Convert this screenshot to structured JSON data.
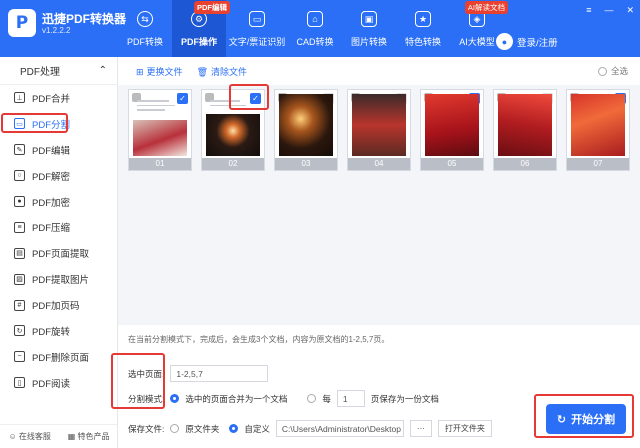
{
  "app": {
    "name": "迅捷PDF转换器",
    "version": "v1.2.2.2",
    "logo_letter": "P"
  },
  "nav": {
    "items": [
      {
        "label": "PDF转换",
        "icon": "convert-icon"
      },
      {
        "label": "PDF操作",
        "icon": "gear-icon",
        "badge": "PDF编辑",
        "active": true
      },
      {
        "label": "文字/票证识别",
        "icon": "scan-icon"
      },
      {
        "label": "CAD转换",
        "icon": "cad-icon"
      },
      {
        "label": "图片转换",
        "icon": "image-icon"
      },
      {
        "label": "特色转换",
        "icon": "star-icon"
      },
      {
        "label": "AI大模型",
        "icon": "ai-icon",
        "badge": "AI解读文档"
      }
    ],
    "login": "登录/注册"
  },
  "sidebar": {
    "header": "PDF处理",
    "items": [
      {
        "label": "PDF合并",
        "icon": "merge-icon"
      },
      {
        "label": "PDF分割",
        "icon": "split-icon",
        "active": true
      },
      {
        "label": "PDF编辑",
        "icon": "edit-icon"
      },
      {
        "label": "PDF解密",
        "icon": "unlock-icon"
      },
      {
        "label": "PDF加密",
        "icon": "lock-icon"
      },
      {
        "label": "PDF压缩",
        "icon": "compress-icon"
      },
      {
        "label": "PDF页面提取",
        "icon": "extract-page-icon"
      },
      {
        "label": "PDF提取图片",
        "icon": "extract-image-icon"
      },
      {
        "label": "PDF加页码",
        "icon": "page-number-icon"
      },
      {
        "label": "PDF旋转",
        "icon": "rotate-icon"
      },
      {
        "label": "PDF删除页面",
        "icon": "delete-page-icon"
      },
      {
        "label": "PDF阅读",
        "icon": "read-icon"
      }
    ],
    "footer": {
      "service": "在线客服",
      "products": "特色产品"
    }
  },
  "toolbar": {
    "change_file": "更换文件",
    "clear_file": "清除文件",
    "select_all": "全选"
  },
  "pages": [
    {
      "num": "01",
      "checked": true
    },
    {
      "num": "02",
      "checked": true
    },
    {
      "num": "03",
      "checked": false
    },
    {
      "num": "04",
      "checked": false
    },
    {
      "num": "05",
      "checked": true
    },
    {
      "num": "06",
      "checked": false
    },
    {
      "num": "07",
      "checked": true
    }
  ],
  "options": {
    "description": "在当前分割模式下，完成后，会生成3个文档，内容为原文档的1-2,5,7页。",
    "selected_pages_label": "选中页面:",
    "selected_pages_value": "1-2,5,7",
    "split_mode_label": "分割模式:",
    "mode_merge_label": "选中的页面合并为一个文档",
    "mode_every_label": "每",
    "mode_every_value": "1",
    "mode_every_suffix": "页保存为一份文档",
    "save_label": "保存文件:",
    "save_original": "原文件夹",
    "save_custom": "自定义",
    "save_path": "C:\\Users\\Administrator\\Desktop",
    "more_button": "···",
    "open_folder": "打开文件夹",
    "start_button": "开始分割"
  },
  "colors": {
    "accent": "#2a6ff6",
    "highlight_box": "#e53935"
  }
}
